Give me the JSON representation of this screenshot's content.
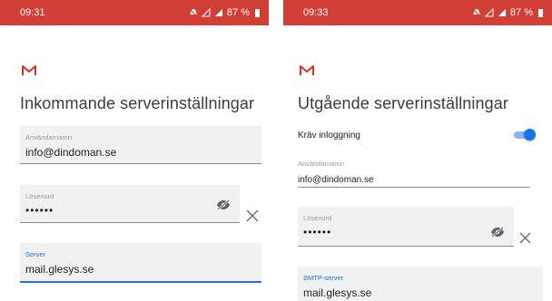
{
  "left": {
    "status": {
      "time": "09:31",
      "battery": "87 %"
    },
    "title": "Inkommande serverinställningar",
    "username": {
      "label": "Användarnamn",
      "value": "info@dindoman.se"
    },
    "password": {
      "label": "Lösenord",
      "value": "••••••"
    },
    "server": {
      "label": "Server",
      "value": "mail.glesys.se"
    }
  },
  "right": {
    "status": {
      "time": "09:33",
      "battery": "87 %"
    },
    "title": "Utgående serverinställningar",
    "require_login": {
      "label": "Kräv inloggning",
      "enabled": true
    },
    "username": {
      "label": "Användarnamn",
      "value": "info@dindoman.se"
    },
    "password": {
      "label": "Lösenord",
      "value": "••••••"
    },
    "smtp": {
      "label": "SMTP-server",
      "value": "mail.glesys.se"
    }
  },
  "colors": {
    "statusbar": "#d03e36",
    "gmail_red": "#d93025",
    "accent": "#1a73e8",
    "field_bg": "#f1f1f1"
  },
  "icons": [
    "gmail-logo",
    "visibility-off-icon",
    "clear-icon",
    "signal-icon",
    "battery-icon"
  ]
}
